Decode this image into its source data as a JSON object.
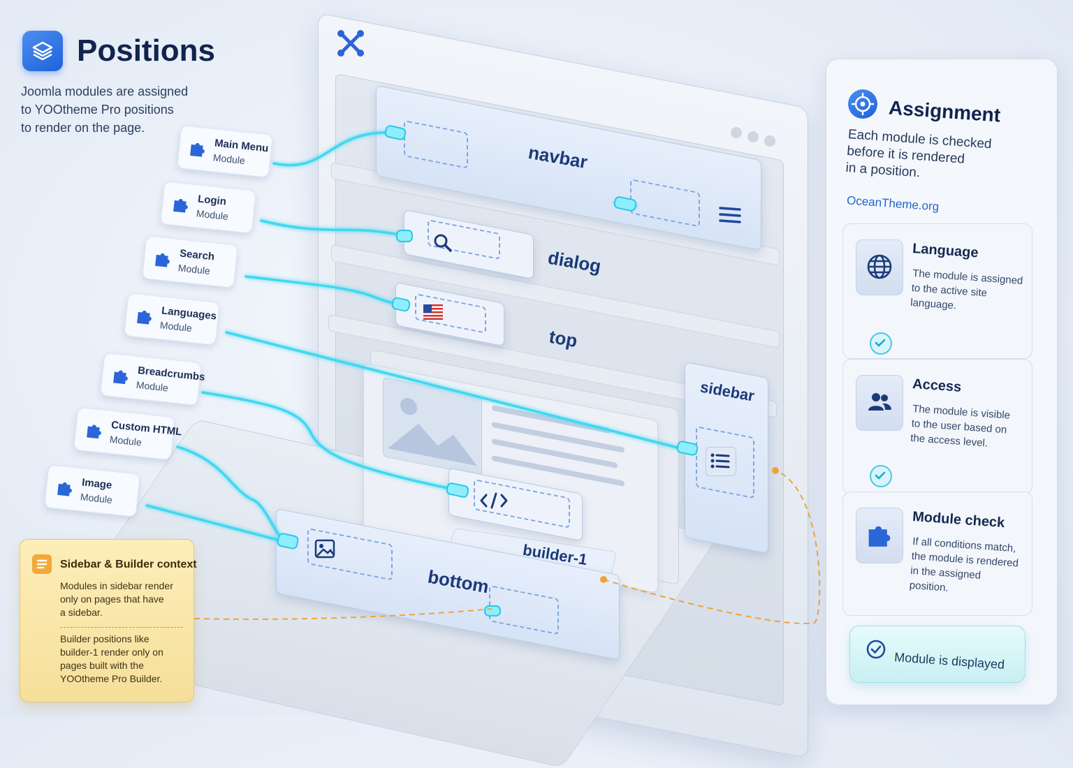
{
  "header": {
    "title": "Positions",
    "subtitle_lines": [
      "Joomla modules are assigned",
      "to YOOtheme Pro positions",
      "to render on the page."
    ],
    "icon": "layers-icon"
  },
  "modules": [
    {
      "name": "Main Menu",
      "type": "Module"
    },
    {
      "name": "Login",
      "type": "Module"
    },
    {
      "name": "Search",
      "type": "Module"
    },
    {
      "name": "Languages",
      "type": "Module"
    },
    {
      "name": "Breadcrumbs",
      "type": "Module"
    },
    {
      "name": "Custom HTML",
      "type": "Module"
    },
    {
      "name": "Image",
      "type": "Module"
    }
  ],
  "positions": {
    "navbar": "navbar",
    "dialog": "dialog",
    "top": "top",
    "sidebar": "sidebar",
    "builder": "builder-1",
    "bottom": "bottom"
  },
  "note": {
    "title": "Sidebar & Builder context",
    "p1_lines": [
      "Modules in sidebar render",
      "only on pages that have",
      "a sidebar."
    ],
    "p2_lines": [
      "Builder positions like",
      "builder-1 render only on",
      "pages built with the",
      "YOOtheme Pro Builder."
    ]
  },
  "assignment": {
    "title": "Assignment",
    "desc_lines": [
      "Each module is checked",
      "before it is rendered",
      "in a position."
    ],
    "link": "OceanTheme.org",
    "steps": [
      {
        "title": "Language",
        "icon": "globe-icon",
        "lines": [
          "The module is assigned",
          "to the active site",
          "language."
        ]
      },
      {
        "title": "Access",
        "icon": "users-icon",
        "lines": [
          "The module is visible",
          "to the user based on",
          "the access level."
        ]
      },
      {
        "title": "Module check",
        "icon": "puzzle-icon",
        "lines": [
          "If all conditions match,",
          "the module is rendered",
          "in the assigned",
          "position."
        ]
      }
    ],
    "result": "Module is displayed"
  },
  "colors": {
    "accent": "#1f62d9",
    "connector": "#3fd8f0",
    "note_bg": "#f8e3a2",
    "dashed_context": "#f0a23a"
  }
}
